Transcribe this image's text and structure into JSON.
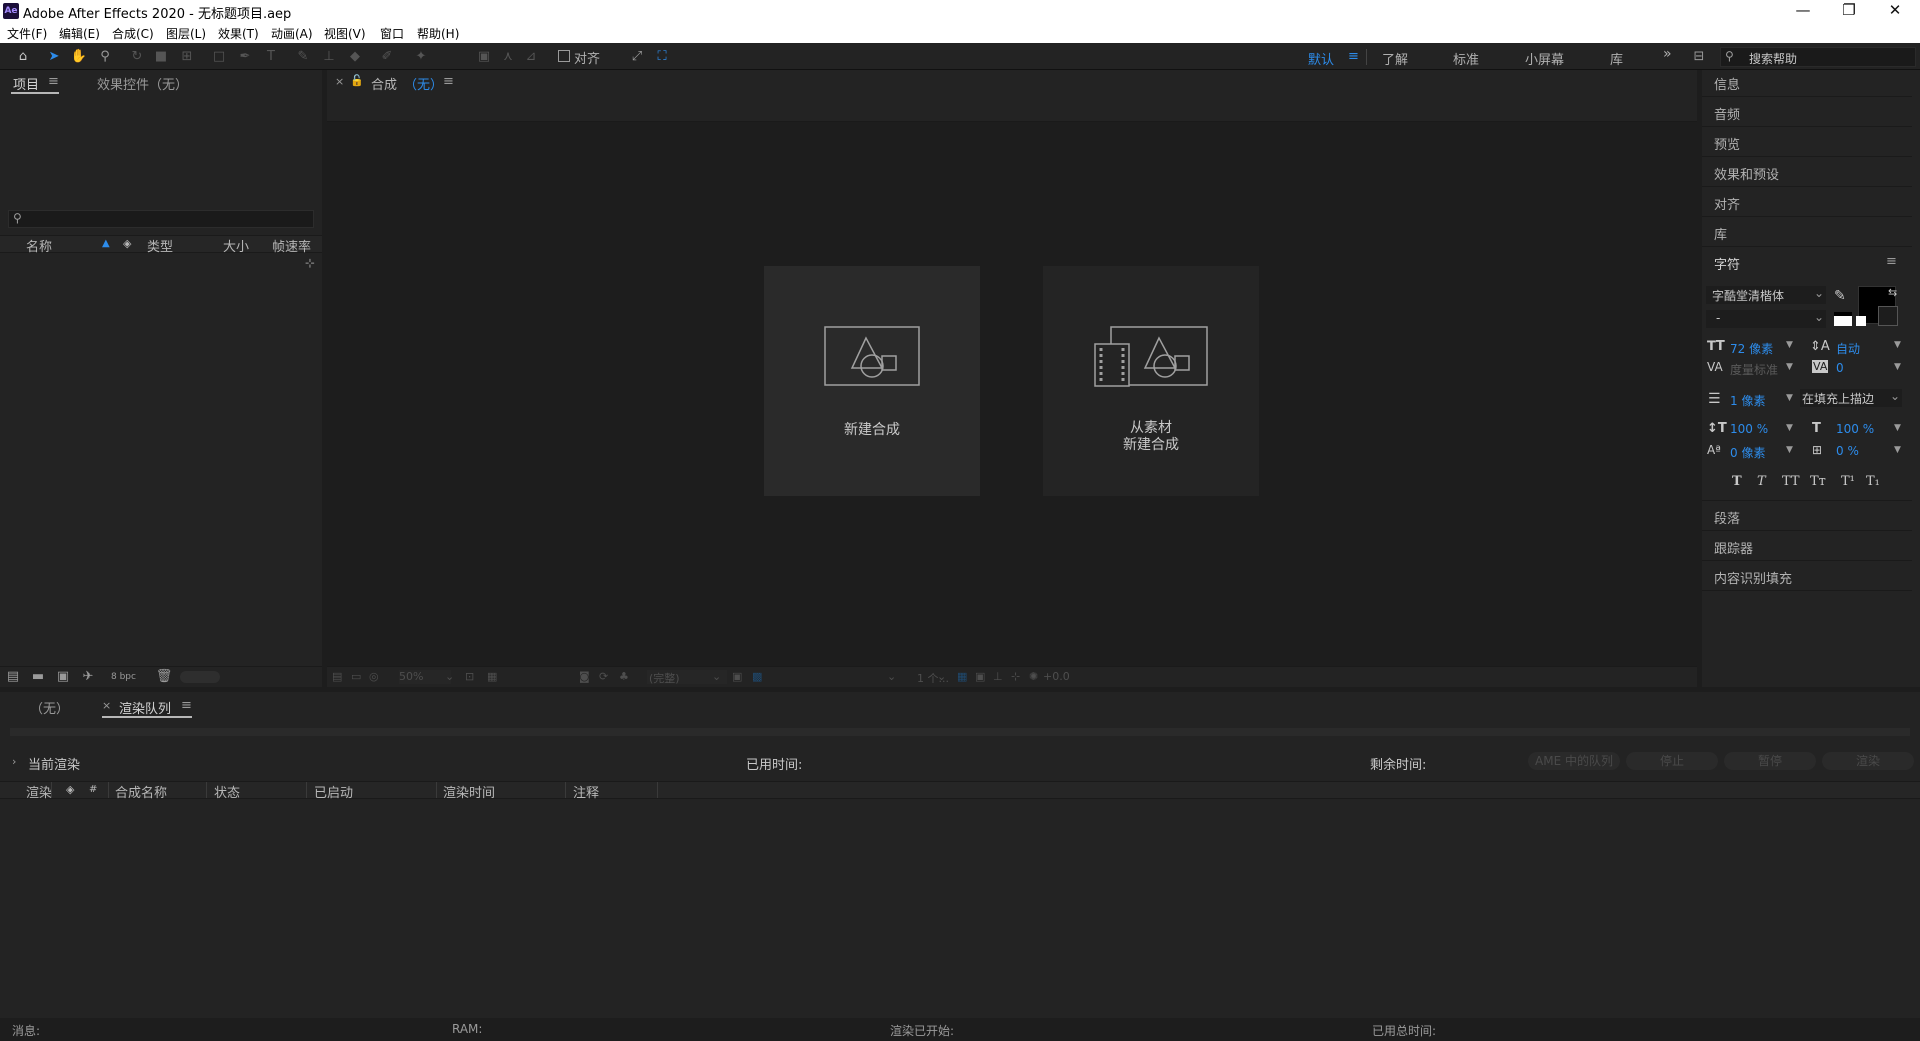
{
  "app": {
    "logo": "Ae",
    "title": "Adobe After Effects 2020 - 无标题项目.aep"
  },
  "window_controls": {
    "minimize": "—",
    "restore": "❐",
    "close": "✕"
  },
  "menu": [
    "文件(F)",
    "编辑(E)",
    "合成(C)",
    "图层(L)",
    "效果(T)",
    "动画(A)",
    "视图(V)",
    "窗口",
    "帮助(H)"
  ],
  "toolbar": {
    "snap_label": "对齐"
  },
  "workspaces": {
    "default": "默认",
    "learn": "了解",
    "standard": "标准",
    "small_screen": "小屏幕",
    "libraries": "库",
    "overflow": "»",
    "search_placeholder": "搜索帮助"
  },
  "project_panel": {
    "tab_project": "项目",
    "tab_effects": "效果控件（无）",
    "columns": [
      "名称",
      "类型",
      "大小",
      "帧速率"
    ],
    "bpc": "8 bpc"
  },
  "comp_panel": {
    "tab_label": "合成",
    "tab_value": "（无）",
    "new_comp": "新建合成",
    "from_footage_line1": "从素材",
    "from_footage_line2": "新建合成",
    "zoom": "50%",
    "quality": "(完整)",
    "views": "1 个...",
    "exposure": "+0.0"
  },
  "right_panel": {
    "items_top": [
      "信息",
      "音频",
      "预览",
      "效果和预设",
      "对齐",
      "库"
    ],
    "character": {
      "title": "字符",
      "font": "字酷堂清楷体",
      "style": "-",
      "size": "72 像素",
      "leading": "自动",
      "kerning": "度量标准",
      "tracking": "0",
      "stroke_width": "1 像素",
      "stroke_type": "在填充上描边",
      "vscale": "100 %",
      "hscale": "100 %",
      "baseline": "0 像素",
      "tsume": "0 %",
      "styles": [
        "T",
        "T",
        "TT",
        "Tт",
        "T¹",
        "T₁"
      ]
    },
    "items_bottom": [
      "段落",
      "跟踪器",
      "内容识别填充"
    ]
  },
  "render_queue": {
    "tab_none": "（无）",
    "tab_label": "渲染队列",
    "current_render": "当前渲染",
    "elapsed": "已用时间:",
    "remaining": "剩余时间:",
    "buttons": [
      "AME 中的队列",
      "停止",
      "暂停",
      "渲染"
    ],
    "columns": [
      "渲染",
      "#",
      "合成名称",
      "状态",
      "已启动",
      "渲染时间",
      "注释"
    ]
  },
  "status_bar": {
    "message": "消息:",
    "ram": "RAM:",
    "render_started": "渲染已开始:",
    "total_time": "已用总时间:"
  },
  "colors": {
    "accent": "#2d8ceb",
    "bg": "#1d1d1d",
    "panel": "#232323"
  }
}
